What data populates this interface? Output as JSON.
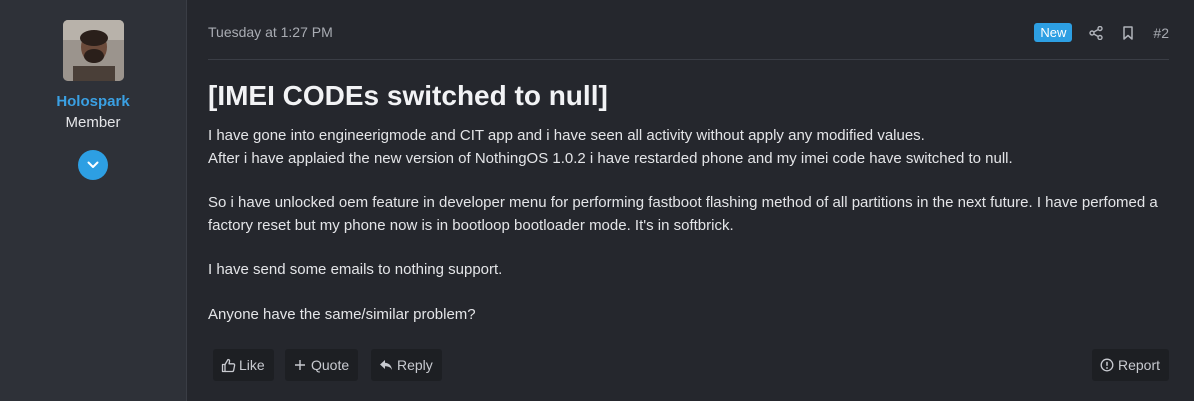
{
  "user": {
    "name": "Holospark",
    "title": "Member"
  },
  "post": {
    "date": "Tuesday at 1:27 PM",
    "badge": "New",
    "number": "#2",
    "title": "[IMEI CODEs switched to null]",
    "paragraphs": [
      "I have gone into engineerigmode and CIT app and i have seen all activity without apply any modified values.",
      "After i have applaied the new version of NothingOS 1.0.2 i have restarded phone and my imei code have switched to null.",
      "So i have unlocked oem feature in developer menu for performing fastboot flashing method of all partitions in the next future. I have perfomed a factory reset but my phone now is in bootloop bootloader mode. It's in softbrick.",
      "I have send some emails to nothing support.",
      "Anyone have the same/similar problem?"
    ]
  },
  "actions": {
    "like": "Like",
    "quote": "Quote",
    "reply": "Reply",
    "report": "Report"
  },
  "colors": {
    "accent": "#2d9fe3",
    "username": "#3aa0e3",
    "background": "#25272d",
    "sidebar": "#2e3138"
  },
  "icons": {
    "expand": "chevron-down-icon",
    "share": "share-icon",
    "bookmark": "bookmark-icon",
    "like": "thumbs-up-icon",
    "quote": "plus-icon",
    "reply": "reply-icon",
    "report": "info-circle-icon"
  }
}
